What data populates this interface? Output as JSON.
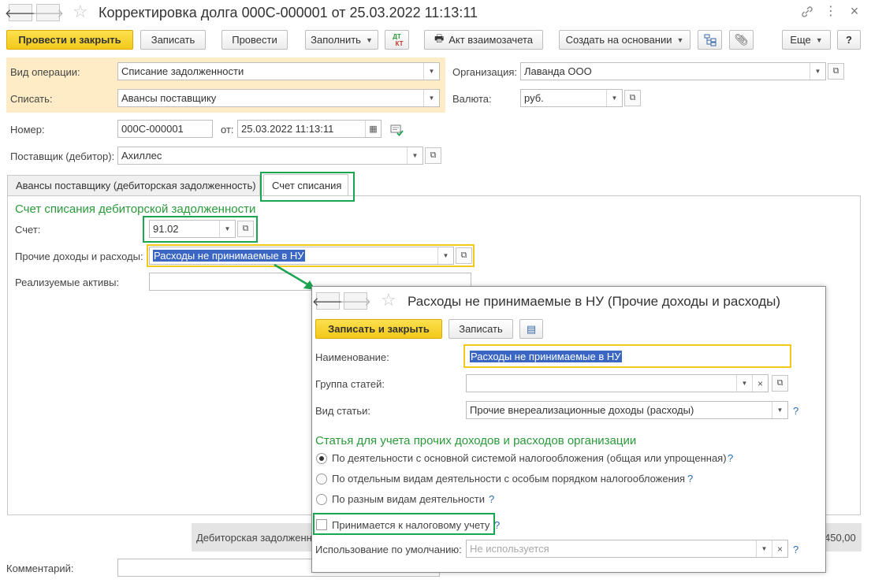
{
  "window": {
    "title": "Корректировка долга 000С-000001 от 25.03.2022 11:13:11",
    "link_icon": "link-icon",
    "more_icon": "vertical-dots-icon",
    "close_icon": "close-icon"
  },
  "toolbar": {
    "post_close": "Провести и закрыть",
    "save": "Записать",
    "post": "Провести",
    "fill": "Заполнить",
    "dtkt_top": "ДТ",
    "dtkt_bottom": "КТ",
    "act": "Акт взаимозачета",
    "create_based": "Создать на основании",
    "more": "Еще",
    "help": "?"
  },
  "form": {
    "operation_label": "Вид операции:",
    "operation_value": "Списание задолженности",
    "writeoff_label": "Списать:",
    "writeoff_value": "Авансы поставщику",
    "org_label": "Организация:",
    "org_value": "Лаванда ООО",
    "currency_label": "Валюта:",
    "currency_value": "руб.",
    "number_label": "Номер:",
    "number_value": "000С-000001",
    "date_label": "от:",
    "date_value": "25.03.2022 11:13:11",
    "supplier_label": "Поставщик (дебитор):",
    "supplier_value": "Ахиллес",
    "comment_label": "Комментарий:",
    "comment_value": ""
  },
  "tabs": [
    {
      "label": "Авансы поставщику (дебиторская задолженность)"
    },
    {
      "label": "Счет списания"
    }
  ],
  "tab_content": {
    "section_title": "Счет списания дебиторской задолженности",
    "account_label": "Счет:",
    "account_value": "91.02",
    "other_label": "Прочие доходы и расходы:",
    "other_value": "Расходы не принимаемые в НУ",
    "assets_label": "Реализуемые активы:",
    "assets_value": ""
  },
  "footer": {
    "debt_label": "Дебиторская задолженн",
    "debt_value": "450,00"
  },
  "popup": {
    "title": "Расходы не принимаемые в НУ (Прочие доходы и расходы)",
    "save_close": "Записать и закрыть",
    "save": "Записать",
    "name_label": "Наименование:",
    "name_value": "Расходы не принимаемые в НУ",
    "group_label": "Группа статей:",
    "group_value": "",
    "kind_label": "Вид статьи:",
    "kind_value": "Прочие внереализационные доходы (расходы)",
    "section_title": "Статья для учета прочих доходов и расходов организации",
    "radio_options": [
      {
        "label": "По деятельности с основной системой налогообложения (общая или упрощенная)",
        "selected": true
      },
      {
        "label": "По отдельным видам деятельности с особым порядком налогообложения",
        "selected": false
      },
      {
        "label": "По разным видам деятельности",
        "selected": false
      }
    ],
    "tax_check_label": "Принимается к налоговому учету",
    "tax_check_checked": false,
    "default_label": "Использование по умолчанию:",
    "default_placeholder": "Не используется",
    "help": "?"
  },
  "colors": {
    "primary_button": "#f3c91a",
    "highlight_bg": "#fdecc6",
    "callout_green": "#1aa550",
    "focus_yellow": "#f3c91a",
    "section_green": "#2a9a3a",
    "selection_blue": "#3a66c4"
  }
}
